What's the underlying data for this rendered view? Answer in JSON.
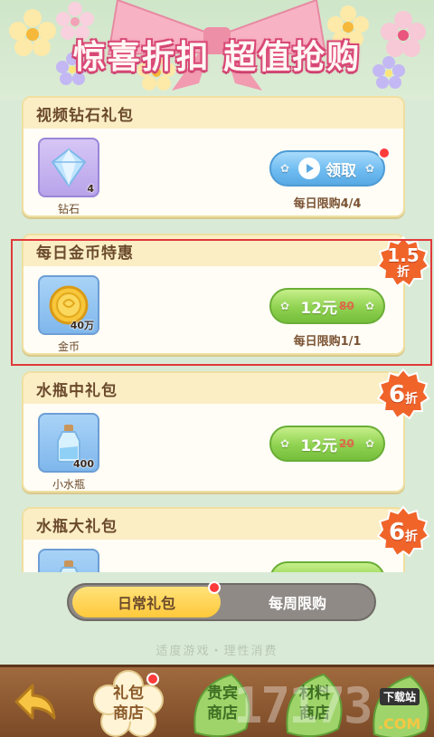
{
  "header": {
    "title": "惊喜折扣 超值抢购"
  },
  "packs": [
    {
      "title": "视频钻石礼包",
      "item_name": "钻石",
      "item_qty": "4",
      "button_label": "领取",
      "button_style": "video",
      "limit": "每日限购4/4",
      "badge": null
    },
    {
      "title": "每日金币特惠",
      "item_name": "金币",
      "item_qty": "40万",
      "price": "12元",
      "old_price": "80",
      "limit": "每日限购1/1",
      "badge": {
        "value": "1.5",
        "unit": "折"
      }
    },
    {
      "title": "水瓶中礼包",
      "item_name": "小水瓶",
      "item_qty": "400",
      "price": "12元",
      "old_price": "20",
      "badge": {
        "value": "6",
        "unit": "折"
      }
    },
    {
      "title": "水瓶大礼包",
      "badge": {
        "value": "6",
        "unit": "折"
      }
    }
  ],
  "tabs": {
    "daily": "日常礼包",
    "weekly": "每周限购"
  },
  "slogan": "适度游戏・理性消费",
  "nav": {
    "gift_shop": [
      "礼包",
      "商店"
    ],
    "vip_shop": [
      "贵宾",
      "商店"
    ],
    "material_shop": [
      "材料",
      "商店"
    ]
  },
  "watermark": {
    "logo": "17173",
    "download": "下载站",
    "domain": ".COM"
  },
  "colors": {
    "accent_pink": "#e4537f",
    "discount_orange": "#f0642a",
    "btn_green": "#8fd250",
    "btn_blue": "#6fbcf1",
    "highlight_red": "#e03a3a"
  }
}
